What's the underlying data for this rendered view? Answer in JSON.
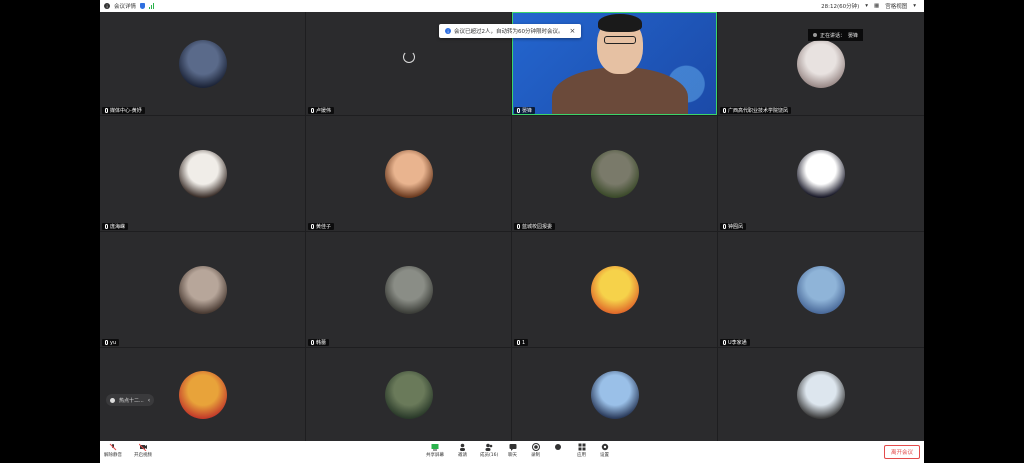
{
  "topbar": {
    "meeting_info": "会议详情",
    "timer": "28:12(60分钟)",
    "view_mode": "宫格视图"
  },
  "toast": {
    "text": "会议已超过2人，自动转为60分钟限时会议。"
  },
  "speaking": {
    "label": "正在讲话：",
    "name": "晏锋"
  },
  "tiles": [
    {
      "name": "媒体中心-黄妤",
      "avatar": [
        "#5a6a8a",
        "#1c2438"
      ]
    },
    {
      "name": "卢媛伟",
      "avatar": null,
      "loading": true
    },
    {
      "name": "晏锋",
      "video": true
    },
    {
      "name": "广西高代职业技术学院饶凤",
      "avatar": [
        "#e8e2e0",
        "#9a8a88"
      ]
    },
    {
      "name": "庞海嵘",
      "avatar": [
        "#f0ede8",
        "#3b2f2a"
      ]
    },
    {
      "name": "黄佳子",
      "avatar": [
        "#e9b48f",
        "#6b3a1f"
      ]
    },
    {
      "name": "蓝城校园报委",
      "avatar": [
        "#7a7a6a",
        "#3b4a2a"
      ]
    },
    {
      "name": "钟囿凤",
      "avatar": [
        "#ffffff",
        "#1a1a2a"
      ]
    },
    {
      "name": "yu",
      "avatar": [
        "#b7a69a",
        "#4a3b33"
      ]
    },
    {
      "name": "韩蕾",
      "avatar": [
        "#8a8d86",
        "#3b3d38"
      ]
    },
    {
      "name": "1",
      "avatar": [
        "#f6d24a",
        "#e06a2a"
      ]
    },
    {
      "name": "U李家通",
      "avatar": [
        "#8fb4d8",
        "#4a6a9a"
      ]
    },
    {
      "name": "",
      "avatar": [
        "#e8a33a",
        "#c23a2a"
      ]
    },
    {
      "name": "",
      "avatar": [
        "#6a7a5a",
        "#2a3a2a"
      ]
    },
    {
      "name": "",
      "avatar": [
        "#9ac0e8",
        "#2a3a5a"
      ]
    },
    {
      "name": "",
      "avatar": [
        "#dde6ee",
        "#3a3a3a"
      ]
    }
  ],
  "collapse_label": "热点十二...",
  "toolbar": {
    "mute": "解除静音",
    "video": "开启视频",
    "share": "共享屏幕",
    "invite": "邀请",
    "members": "成员(16)",
    "chat": "聊天",
    "record": "录制",
    "apps": "应用",
    "settings": "设置",
    "extra": "",
    "leave": "离开会议"
  }
}
